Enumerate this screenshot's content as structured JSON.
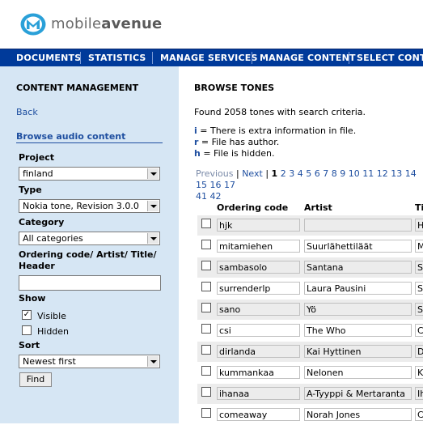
{
  "brand": {
    "light": "mobile",
    "bold": "avenue"
  },
  "nav": [
    {
      "label": "DOCUMENTS"
    },
    {
      "label": "STATISTICS"
    },
    {
      "label": "MANAGE SERVICES"
    },
    {
      "label": "MANAGE CONTENT"
    },
    {
      "label": "SELECT CONTENT"
    }
  ],
  "sidebar": {
    "title": "CONTENT MANAGEMENT",
    "back": "Back",
    "browse": "Browse audio content",
    "project_label": "Project",
    "project_value": "finland",
    "type_label": "Type",
    "type_value": "Nokia tone, Revision 3.0.0",
    "category_label": "Category",
    "category_value": "All categories",
    "search_label_1": "Ordering code/ Artist/ Title/",
    "search_label_2": "Header",
    "search_value": "",
    "show_label": "Show",
    "visible_label": "Visible",
    "visible_checked": "✓",
    "hidden_label": "Hidden",
    "sort_label": "Sort",
    "sort_value": "Newest first",
    "find_label": "Find"
  },
  "main": {
    "title": "BROWSE TONES",
    "found": "Found 2058 tones with search criteria.",
    "legend": [
      {
        "key": "i",
        "text": " = There is extra information in file."
      },
      {
        "key": "r",
        "text": " = File has author."
      },
      {
        "key": "h",
        "text": " = File is hidden."
      }
    ],
    "pager": {
      "prev": "Previous",
      "sep": " | ",
      "next": "Next",
      "current": "1",
      "pages": [
        "2",
        "3",
        "4",
        "5",
        "6",
        "7",
        "8",
        "9",
        "10",
        "11",
        "12",
        "13",
        "14",
        "15",
        "16",
        "17"
      ],
      "pages2": [
        "41",
        "42"
      ]
    },
    "columns": {
      "code": "Ordering code",
      "artist": "Artist",
      "title": "Ti"
    },
    "rows": [
      {
        "code": "hjk",
        "artist": "",
        "title": "He"
      },
      {
        "code": "mitamiehen",
        "artist": "Suurlähettiläät",
        "title": "M"
      },
      {
        "code": "sambasolo",
        "artist": "Santana",
        "title": "Sa"
      },
      {
        "code": "surrenderlp",
        "artist": "Laura Pausini",
        "title": "Su"
      },
      {
        "code": "sano",
        "artist": "Yö",
        "title": "Sa"
      },
      {
        "code": "csi",
        "artist": "The Who",
        "title": "C"
      },
      {
        "code": "dirlanda",
        "artist": "Kai Hyttinen",
        "title": "Di"
      },
      {
        "code": "kummankaa",
        "artist": "Nelonen",
        "title": "Ku"
      },
      {
        "code": "ihanaa",
        "artist": "A-Tyyppi & Mertaranta",
        "title": "Ih"
      },
      {
        "code": "comeaway",
        "artist": "Norah Jones",
        "title": "C"
      }
    ]
  },
  "colors": {
    "nav_bg": "#003a9a",
    "sidebar_bg": "#d6e6f4",
    "link": "#1f4fa0",
    "logo": "#2aa0d8"
  }
}
